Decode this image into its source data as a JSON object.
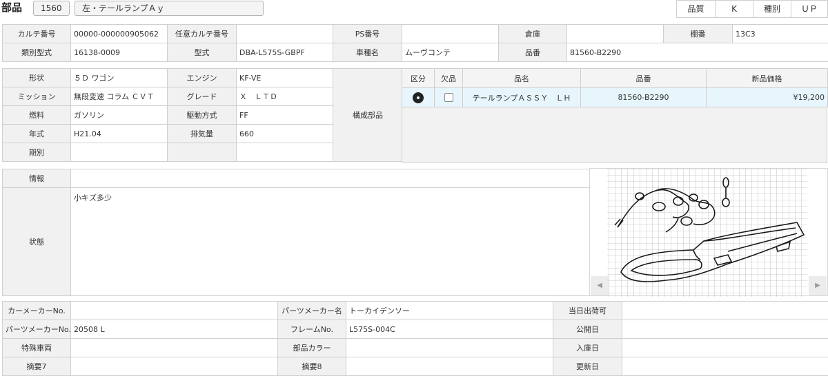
{
  "header": {
    "title": "部品",
    "part_code": "1560",
    "part_name": "左・テールランプＡｙ",
    "quality_label": "品質",
    "quality_value": "K",
    "kind_label": "種別",
    "kind_value": "ＵＰ"
  },
  "info1": {
    "karte_no_label": "カルテ番号",
    "karte_no": "00000-000000905062",
    "opt_karte_label": "任意カルテ番号",
    "opt_karte": "",
    "ps_label": "PS番号",
    "ps": "",
    "warehouse_label": "倉庫",
    "warehouse": "",
    "shelf_label": "棚番",
    "shelf": "13C3",
    "class_model_label": "類別型式",
    "class_model": "16138-0009",
    "model_label": "型式",
    "model": "DBA-L575S-GBPF",
    "car_name_label": "車種名",
    "car_name": "ムーヴコンテ",
    "part_no_label": "品番",
    "part_no": "81560-B2290"
  },
  "info2": {
    "shape_label": "形状",
    "shape": "５Ｄ ワゴン",
    "engine_label": "エンジン",
    "engine": "KF-VE",
    "mission_label": "ミッション",
    "mission": "無段変速 コラム ＣＶＴ",
    "grade_label": "グレード",
    "grade": "Ｘ　ＬＴＤ",
    "fuel_label": "燃料",
    "fuel": "ガソリン",
    "drive_label": "駆動方式",
    "drive": "FF",
    "year_label": "年式",
    "year": "H21.04",
    "displacement_label": "排気量",
    "displacement": "660",
    "period_label": "期別",
    "period": "",
    "components_label": "構成部品"
  },
  "parts": {
    "headers": [
      "区分",
      "欠品",
      "品名",
      "品番",
      "新品価格"
    ],
    "rows": [
      {
        "name": "テールランプＡＳＳＹ　ＬＨ",
        "number": "81560-B2290",
        "price": "¥19,200",
        "missing": false,
        "category_icon": "disc-icon"
      }
    ]
  },
  "info3": {
    "info_label": "情報",
    "info": "",
    "state_label": "状態",
    "state": "小キズ多少"
  },
  "viewer": {
    "image": "tail-lamp-diagram",
    "prev_icon": "triangle-left-icon",
    "next_icon": "triangle-right-icon"
  },
  "info4": {
    "car_maker_no_label": "カーメーカーNo.",
    "car_maker_no": "",
    "parts_maker_name_label": "パーツメーカー名",
    "parts_maker_name": "トーカイデンソー",
    "shipping_today_label": "当日出荷可",
    "shipping_today": "",
    "parts_maker_no_label": "パーツメーカーNo.",
    "parts_maker_no": "20508 L",
    "frame_no_label": "フレームNo.",
    "frame_no": "L575S-004C",
    "public_date_label": "公開日",
    "public_date": "",
    "special_vehicle_label": "特殊車両",
    "special_vehicle": "",
    "part_color_label": "部品カラー",
    "part_color": "",
    "arrival_date_label": "入庫日",
    "arrival_date": "",
    "summary7_label": "摘要7",
    "summary7": "",
    "summary8_label": "摘要8",
    "summary8": "",
    "update_date_label": "更新日",
    "update_date": ""
  },
  "colors": {
    "label_bg": "#f1f1f1",
    "border": "#cfcfcf",
    "row_highlight": "#e6f6fc"
  }
}
